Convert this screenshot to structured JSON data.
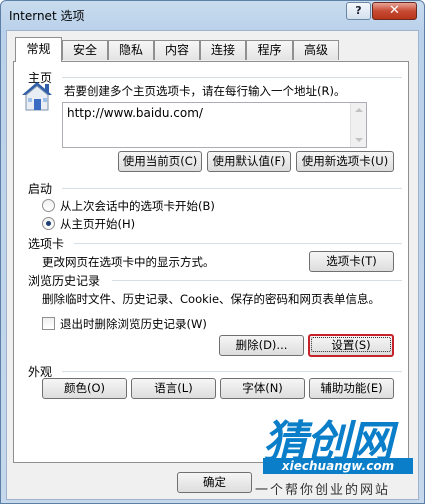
{
  "window": {
    "title": "Internet 选项",
    "help_label": "?",
    "close_label": "✕"
  },
  "tabs": [
    {
      "label": "常规",
      "active": true
    },
    {
      "label": "安全"
    },
    {
      "label": "隐私"
    },
    {
      "label": "内容"
    },
    {
      "label": "连接"
    },
    {
      "label": "程序"
    },
    {
      "label": "高级"
    }
  ],
  "home": {
    "section_label": "主页",
    "description": "若要创建多个主页选项卡，请在每行输入一个地址(R)。",
    "url": "http://www.baidu.com/",
    "btn_use_current": "使用当前页(C)",
    "btn_use_default": "使用默认值(F)",
    "btn_use_new_tab": "使用新选项卡(U)"
  },
  "startup": {
    "section_label": "启动",
    "option_last_session": "从上次会话中的选项卡开始(B)",
    "option_home_page": "从主页开始(H)"
  },
  "tabs_section": {
    "section_label": "选项卡",
    "description": "更改网页在选项卡中的显示方式。",
    "btn_tabs": "选项卡(T)"
  },
  "history": {
    "section_label": "浏览历史记录",
    "description": "删除临时文件、历史记录、Cookie、保存的密码和网页表单信息。",
    "checkbox_label": "退出时删除浏览历史记录(W)",
    "btn_delete": "删除(D)...",
    "btn_settings": "设置(S)"
  },
  "appearance": {
    "section_label": "外观",
    "btn_colors": "颜色(O)",
    "btn_languages": "语言(L)",
    "btn_fonts": "字体(N)",
    "btn_accessibility": "辅助功能(E)"
  },
  "footer": {
    "btn_ok": "确定"
  },
  "watermark": {
    "logo_text": "猜创网",
    "url_text": "xiechuangw.com",
    "slogan": "一个帮你创业的网站"
  }
}
